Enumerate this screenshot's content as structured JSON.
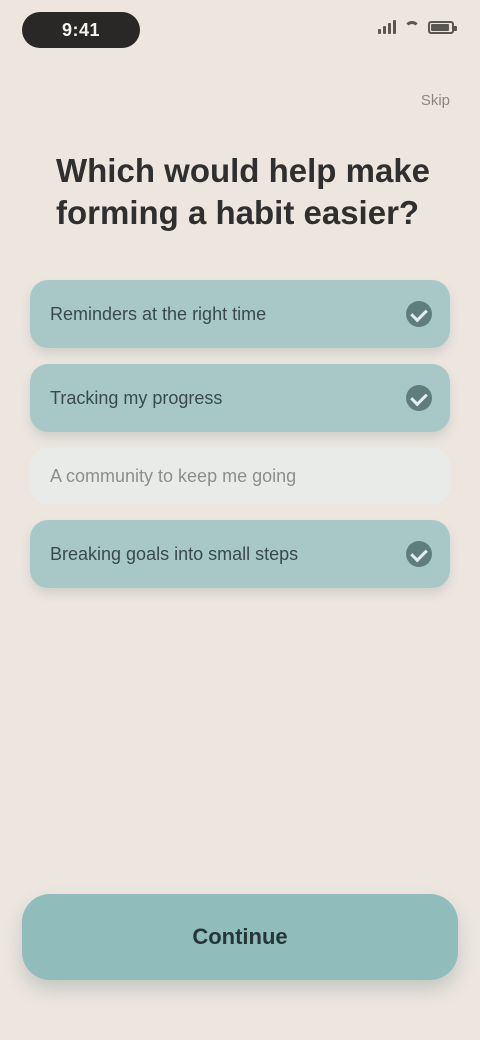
{
  "status_bar": {
    "time": "9:41",
    "battery_level": 0.9
  },
  "header": {
    "skip_label": "Skip"
  },
  "question": {
    "title": "Which would help make forming a habit easier?"
  },
  "options": [
    {
      "label": "Reminders at the right time",
      "selected": true
    },
    {
      "label": "Tracking my progress",
      "selected": true
    },
    {
      "label": "A community to keep me going",
      "selected": false
    },
    {
      "label": "Breaking goals into small steps",
      "selected": true
    }
  ],
  "footer": {
    "continue_label": "Continue"
  },
  "colors": {
    "background": "#ede6df",
    "option_selected": "#a8c8c8",
    "option_unselected": "#e9ebe8",
    "accent": "#91bcbc"
  },
  "icons": {
    "option_check": "check-circle-icon",
    "signal": "signal-icon",
    "wifi": "wifi-icon",
    "battery": "battery-icon"
  }
}
